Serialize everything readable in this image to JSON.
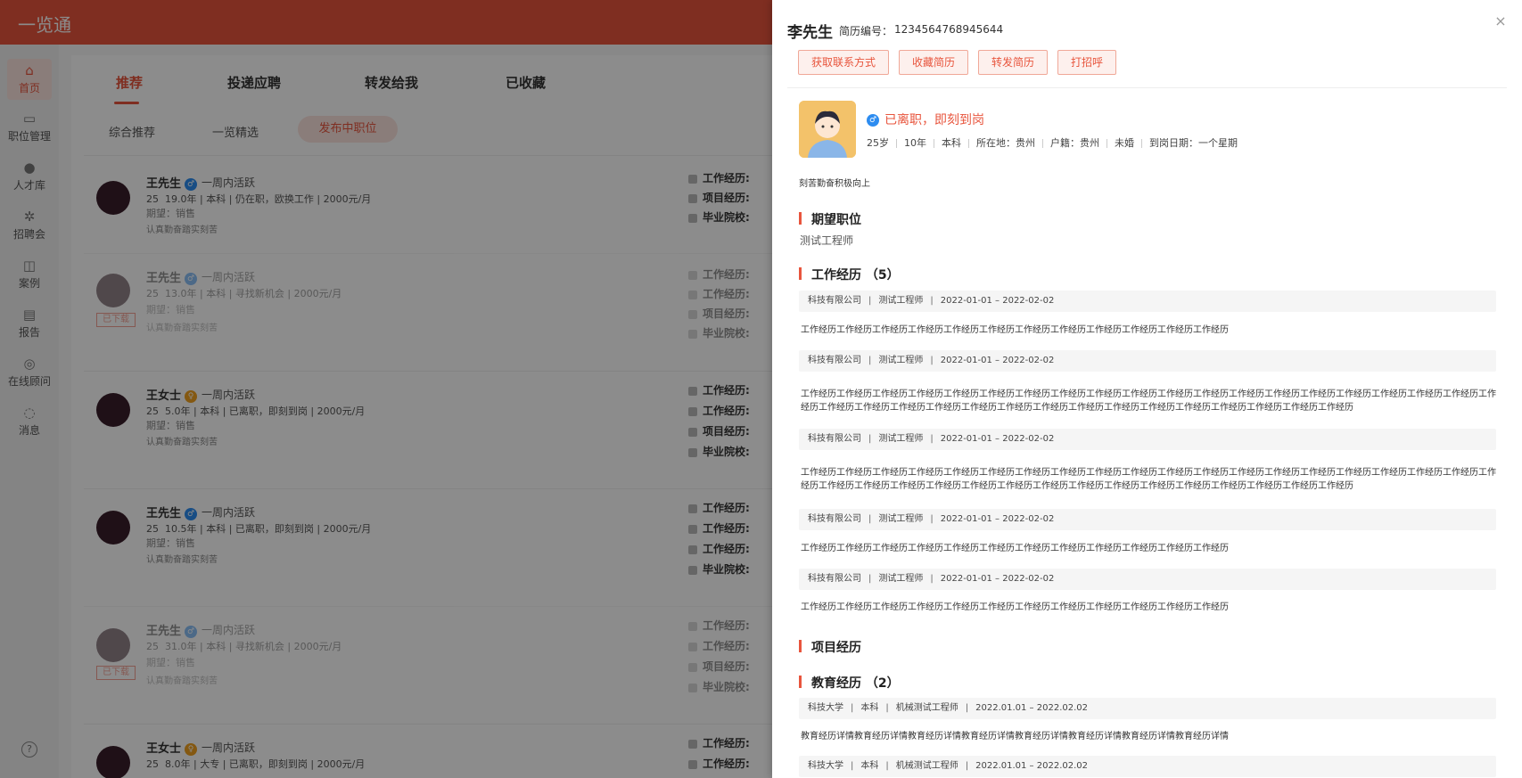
{
  "app": {
    "title": "一览通"
  },
  "sidebar": {
    "items": [
      {
        "label": "首页",
        "icon": "home-icon",
        "glyph": "⌂"
      },
      {
        "label": "职位管理",
        "icon": "briefcase-icon",
        "glyph": "▭"
      },
      {
        "label": "人才库",
        "icon": "person-icon",
        "glyph": "●"
      },
      {
        "label": "招聘会",
        "icon": "aperture-icon",
        "glyph": "✲"
      },
      {
        "label": "案例",
        "icon": "book-icon",
        "glyph": "◫"
      },
      {
        "label": "报告",
        "icon": "clipboard-icon",
        "glyph": "▤"
      },
      {
        "label": "在线顾问",
        "icon": "advisor-icon",
        "glyph": "◎"
      },
      {
        "label": "消息",
        "icon": "message-icon",
        "glyph": "◌"
      }
    ],
    "help_glyph": "?"
  },
  "tabs": [
    "推荐",
    "投递应聘",
    "转发给我",
    "已收藏"
  ],
  "subtabs": [
    "综合推荐",
    "一览精选",
    "发布中职位"
  ],
  "candidates": [
    {
      "name": "王先生",
      "gender": "♂",
      "active": "一周内活跃",
      "age": "25",
      "meta": "19.0年 | 本科 | 仍在职，欧换工作 | 2000元/月",
      "expect": "期望：销售",
      "note": "认真勤奋踏实刻苦",
      "labels": [
        "工作经历:",
        "项目经历:",
        "毕业院校:"
      ]
    },
    {
      "name": "王先生",
      "gender": "♂",
      "active": "一周内活跃",
      "age": "25",
      "meta": "13.0年 | 本科 | 寻找新机会 | 2000元/月",
      "expect": "期望：销售",
      "note": "认真勤奋踏实刻苦",
      "badge": "已下载",
      "labels": [
        "工作经历:",
        "工作经历:",
        "项目经历:",
        "毕业院校:"
      ]
    },
    {
      "name": "王女士",
      "gender": "♀",
      "active": "一周内活跃",
      "age": "25",
      "meta": "5.0年 | 本科 | 已离职，即刻到岗 | 2000元/月",
      "expect": "期望：销售",
      "note": "认真勤奋踏实刻苦",
      "labels": [
        "工作经历:",
        "工作经历:",
        "项目经历:",
        "毕业院校:"
      ]
    },
    {
      "name": "王先生",
      "gender": "♂",
      "active": "一周内活跃",
      "age": "25",
      "meta": "10.5年 | 本科 | 已离职，即刻到岗 | 2000元/月",
      "expect": "期望：销售",
      "note": "认真勤奋踏实刻苦",
      "labels": [
        "工作经历:",
        "工作经历:",
        "工作经历:",
        "毕业院校:"
      ]
    },
    {
      "name": "王先生",
      "gender": "♂",
      "active": "一周内活跃",
      "age": "25",
      "meta": "31.0年 | 本科 | 寻找新机会 | 2000元/月",
      "expect": "期望：销售",
      "note": "认真勤奋踏实刻苦",
      "badge": "已下载",
      "labels": [
        "工作经历:",
        "工作经历:",
        "项目经历:",
        "毕业院校:"
      ]
    },
    {
      "name": "王女士",
      "gender": "♀",
      "active": "一周内活跃",
      "age": "25",
      "meta": "8.0年 | 大专 | 已离职，即刻到岗 | 2000元/月",
      "expect": "",
      "note": "",
      "labels": [
        "工作经历:",
        "工作经历:"
      ]
    }
  ],
  "drawer": {
    "name": "李先生",
    "id_label": "简历编号：",
    "id_value": "1234564768945644",
    "actions": [
      "获取联系方式",
      "收藏简历",
      "转发简历",
      "打招呼"
    ],
    "close": "×",
    "status": "已离职，即刻到岗",
    "gender": "♂",
    "info": [
      "25岁",
      "10年",
      "本科",
      "所在地：贵州",
      "户籍：贵州",
      "未婚",
      "到岗日期：一个星期"
    ],
    "intro": "刻苦勤奋积极向上",
    "expected_title": "期望职位",
    "expected_job": "测试工程师",
    "work_title": "工作经历 （5）",
    "work": [
      {
        "company": "科技有限公司",
        "role": "测试工程师",
        "period": "2022-01-01 – 2022-02-02",
        "desc": "工作经历工作经历工作经历工作经历工作经历工作经历工作经历工作经历工作经历工作经历工作经历工作经历"
      },
      {
        "company": "科技有限公司",
        "role": "测试工程师",
        "period": "2022-01-01 – 2022-02-02",
        "desc": "工作经历工作经历工作经历工作经历工作经历工作经历工作经历工作经历工作经历工作经历工作经历工作经历工作经历工作经历工作经历工作经历工作经历工作经历工作经历工作经历工作经历工作经历工作经历工作经历工作经历工作经历工作经历工作经历工作经历工作经历工作经历工作经历工作经历工作经历工作经历"
      },
      {
        "company": "科技有限公司",
        "role": "测试工程师",
        "period": "2022-01-01 – 2022-02-02",
        "desc": "工作经历工作经历工作经历工作经历工作经历工作经历工作经历工作经历工作经历工作经历工作经历工作经历工作经历工作经历工作经历工作经历工作经历工作经历工作经历工作经历工作经历工作经历工作经历工作经历工作经历工作经历工作经历工作经历工作经历工作经历工作经历工作经历工作经历工作经历工作经历"
      },
      {
        "company": "科技有限公司",
        "role": "测试工程师",
        "period": "2022-01-01 – 2022-02-02",
        "desc": "工作经历工作经历工作经历工作经历工作经历工作经历工作经历工作经历工作经历工作经历工作经历工作经历"
      },
      {
        "company": "科技有限公司",
        "role": "测试工程师",
        "period": "2022-01-01 – 2022-02-02",
        "desc": "工作经历工作经历工作经历工作经历工作经历工作经历工作经历工作经历工作经历工作经历工作经历工作经历"
      }
    ],
    "project_title": "项目经历",
    "edu_title": "教育经历 （2）",
    "education": [
      {
        "school": "科技大学",
        "degree": "本科",
        "major": "机械测试工程师",
        "period": "2022.01.01 – 2022.02.02",
        "desc": "教育经历详情教育经历详情教育经历详情教育经历详情教育经历详情教育经历详情教育经历详情教育经历详情"
      },
      {
        "school": "科技大学",
        "degree": "本科",
        "major": "机械测试工程师",
        "period": "2022.01.01 – 2022.02.02"
      }
    ]
  }
}
